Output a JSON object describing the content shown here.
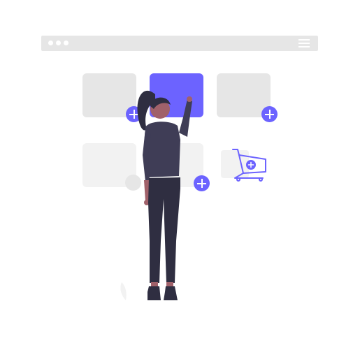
{
  "illustration": {
    "browser": {
      "dots": [
        "dot-1",
        "dot-2",
        "dot-3"
      ],
      "menu_icon": "hamburger-menu-icon"
    },
    "cards": [
      {
        "name": "product-card-1",
        "state": "inactive",
        "has_add_button": true
      },
      {
        "name": "product-card-2",
        "state": "selected",
        "has_add_button": false
      },
      {
        "name": "product-card-3",
        "state": "inactive",
        "has_add_button": true
      },
      {
        "name": "product-card-4",
        "state": "faded",
        "has_add_button": false
      },
      {
        "name": "product-card-5",
        "state": "faded",
        "has_add_button": true
      },
      {
        "name": "product-card-6",
        "state": "faded",
        "has_add_button": false
      }
    ],
    "icons": {
      "add": "plus-circle-icon",
      "cart": "shopping-cart-add-icon",
      "person": "woman-selecting-card-figure"
    },
    "colors": {
      "accent": "#6c63ff",
      "card": "#e6e6e6",
      "card_faded": "#f2f2f2",
      "figure_dark": "#2f2e41",
      "figure_top": "#3f3d56",
      "skin": "#a0616a"
    }
  }
}
